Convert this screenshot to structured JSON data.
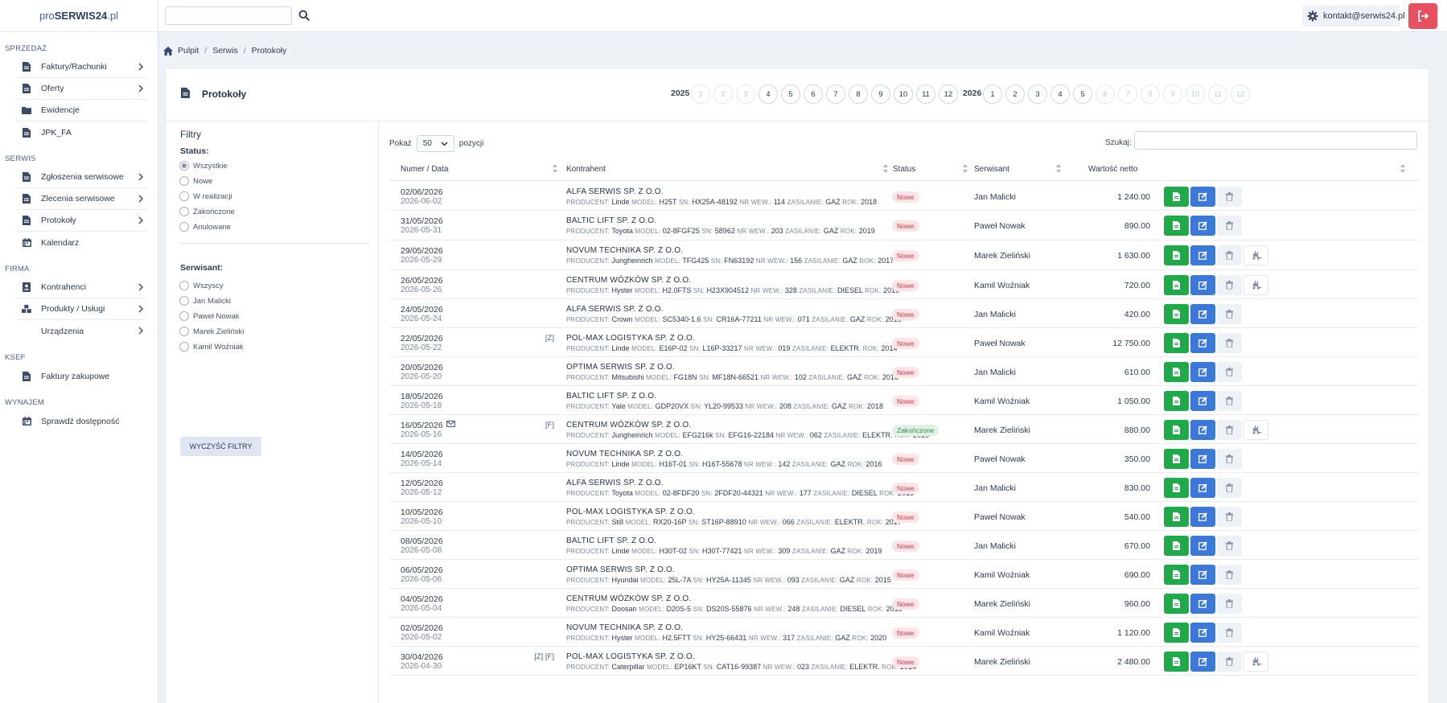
{
  "brand": {
    "prefix": "pro",
    "name": "SERWIS24",
    "suffix": ".pl"
  },
  "sidebar": {
    "sections": [
      {
        "title": "SPRZEDAŻ",
        "items": [
          {
            "label": "Faktury/Rachunki",
            "icon": "document-icon",
            "chevron": true
          },
          {
            "label": "Oferty",
            "icon": "document-icon",
            "chevron": true
          },
          {
            "label": "Ewidencje",
            "icon": "folder-icon",
            "chevron": false
          },
          {
            "label": "JPK_FA",
            "icon": "document-icon",
            "chevron": false
          }
        ]
      },
      {
        "title": "SERWIS",
        "items": [
          {
            "label": "Zgłoszenia serwisowe",
            "icon": "document-icon",
            "chevron": true
          },
          {
            "label": "Zlecenia serwisowe",
            "icon": "document-icon",
            "chevron": true
          },
          {
            "label": "Protokoły",
            "icon": "document-icon",
            "chevron": true
          },
          {
            "label": "Kalendarz",
            "icon": "calendar-icon",
            "chevron": false
          }
        ]
      },
      {
        "title": "FIRMA",
        "items": [
          {
            "label": "Kontrahenci",
            "icon": "contacts-icon",
            "chevron": true
          },
          {
            "label": "Produkty / Usługi",
            "icon": "boxes-icon",
            "chevron": true
          },
          {
            "label": "Urządzenia",
            "icon": "",
            "chevron": true
          }
        ]
      },
      {
        "title": "KSeF",
        "items": [
          {
            "label": "Faktury zakupowe",
            "icon": "document-icon",
            "chevron": false
          }
        ]
      },
      {
        "title": "WYNAJEM",
        "items": [
          {
            "label": "Sprawdź dostępność",
            "icon": "calendar-icon",
            "chevron": false
          }
        ]
      }
    ]
  },
  "topbar": {
    "search_placeholder": "",
    "user_email": "kontakt@serwis24.pl"
  },
  "breadcrumb": {
    "home": "Pulpit",
    "level1": "Serwis",
    "level2": "Protokoły"
  },
  "page": {
    "title": "Protokoły"
  },
  "years": [
    {
      "year": "2025",
      "months": [
        {
          "n": "1",
          "enabled": false
        },
        {
          "n": "2",
          "enabled": false
        },
        {
          "n": "3",
          "enabled": false
        },
        {
          "n": "4",
          "enabled": true
        },
        {
          "n": "5",
          "enabled": true
        },
        {
          "n": "6",
          "enabled": true
        },
        {
          "n": "7",
          "enabled": true
        },
        {
          "n": "8",
          "enabled": true
        },
        {
          "n": "9",
          "enabled": true
        },
        {
          "n": "10",
          "enabled": true
        },
        {
          "n": "11",
          "enabled": true
        },
        {
          "n": "12",
          "enabled": true
        }
      ]
    },
    {
      "year": "2026",
      "months": [
        {
          "n": "1",
          "enabled": true
        },
        {
          "n": "2",
          "enabled": true
        },
        {
          "n": "3",
          "enabled": true
        },
        {
          "n": "4",
          "enabled": true
        },
        {
          "n": "5",
          "enabled": true
        },
        {
          "n": "6",
          "enabled": false
        },
        {
          "n": "7",
          "enabled": false
        },
        {
          "n": "8",
          "enabled": false
        },
        {
          "n": "9",
          "enabled": false
        },
        {
          "n": "10",
          "enabled": false
        },
        {
          "n": "11",
          "enabled": false
        },
        {
          "n": "12",
          "enabled": false
        }
      ]
    }
  ],
  "filters": {
    "title": "Filtry",
    "status_label": "Status:",
    "status_options": [
      "Wszystkie",
      "Nowe",
      "W realizacji",
      "Zakończone",
      "Anulowane"
    ],
    "status_selected": 0,
    "tech_label": "Serwisant:",
    "tech_options": [
      "Wszyscy",
      "Jan Malicki",
      "Paweł Nowak",
      "Marek Zieliński",
      "Kamil Woźniak"
    ],
    "tech_selected": -1,
    "clear_label": "WYCZYŚĆ FILTRY"
  },
  "table": {
    "show_prefix": "Pokaż",
    "show_value": "50",
    "show_suffix": "pozycji",
    "search_label": "Szukaj:",
    "headers": {
      "date": "Numer / Data",
      "client": "Kontrahent",
      "status": "Status",
      "tech": "Serwisant",
      "value": "Wartość netto"
    },
    "field_labels": {
      "producer": "PRODUCENT:",
      "model": "MODEL:",
      "sn": "SN:",
      "nr": "NR WEW.:",
      "power": "ZASILANIE:",
      "year": "ROK:"
    },
    "colors": {
      "new_badge": "#fde4e6",
      "done_badge": "#dff2e4",
      "pdf": "#1faa4a",
      "edit": "#3b78d8",
      "logout": "#e8505f"
    },
    "rows": [
      {
        "date": "02/06/2026",
        "date2": "2026-06-02",
        "flags": "",
        "mail": false,
        "client": "ALFA SERWIS SP. Z O.O.",
        "producer": "Linde",
        "model": "H25T",
        "sn": "HX25A-48192",
        "nr": "114",
        "power": "GAZ",
        "year": "2018",
        "status": "Nowe",
        "tech": "Jan Malicki",
        "value": "1 240.00",
        "fork": false
      },
      {
        "date": "31/05/2026",
        "date2": "2026-05-31",
        "flags": "",
        "mail": false,
        "client": "BALTIC LIFT SP. Z O.O.",
        "producer": "Toyota",
        "model": "02-8FGF25",
        "sn": "58962",
        "nr": "203",
        "power": "GAZ",
        "year": "2019",
        "status": "Nowe",
        "tech": "Paweł Nowak",
        "value": "890.00",
        "fork": false
      },
      {
        "date": "29/05/2026",
        "date2": "2026-05-29",
        "flags": "",
        "mail": false,
        "client": "NOVUM TECHNIKA SP. Z O.O.",
        "producer": "Jungheinrich",
        "model": "TFG425",
        "sn": "FN63192",
        "nr": "156",
        "power": "GAZ",
        "year": "2017",
        "status": "Nowe",
        "tech": "Marek Zieliński",
        "value": "1 630.00",
        "fork": true
      },
      {
        "date": "26/05/2026",
        "date2": "2026-05-26",
        "flags": "",
        "mail": false,
        "client": "CENTRUM WÓZKÓW SP. Z O.O.",
        "producer": "Hyster",
        "model": "H2.0FTS",
        "sn": "H23X904512",
        "nr": "328",
        "power": "DIESEL",
        "year": "2016",
        "status": "Nowe",
        "tech": "Kamil Woźniak",
        "value": "720.00",
        "fork": true
      },
      {
        "date": "24/05/2026",
        "date2": "2026-05-24",
        "flags": "",
        "mail": false,
        "client": "ALFA SERWIS SP. Z O.O.",
        "producer": "Crown",
        "model": "SC5340-1.6",
        "sn": "CR16A-77211",
        "nr": "071",
        "power": "GAZ",
        "year": "2015",
        "status": "Nowe",
        "tech": "Jan Malicki",
        "value": "420.00",
        "fork": false
      },
      {
        "date": "22/05/2026",
        "date2": "2026-05-22",
        "flags": "[Z]",
        "mail": false,
        "client": "POL-MAX LOGISTYKA SP. Z O.O.",
        "producer": "Linde",
        "model": "E16P-02",
        "sn": "L16P-33217",
        "nr": "019",
        "power": "ELEKTR.",
        "year": "2014",
        "status": "Nowe",
        "tech": "Paweł Nowak",
        "value": "12 750.00",
        "fork": false
      },
      {
        "date": "20/05/2026",
        "date2": "2026-05-20",
        "flags": "",
        "mail": false,
        "client": "OPTIMA SERWIS SP. Z O.O.",
        "producer": "Mitsubishi",
        "model": "FG18N",
        "sn": "MF18N-66521",
        "nr": "102",
        "power": "GAZ",
        "year": "2016",
        "status": "Nowe",
        "tech": "Jan Malicki",
        "value": "610.00",
        "fork": false
      },
      {
        "date": "18/05/2026",
        "date2": "2026-05-18",
        "flags": "",
        "mail": false,
        "client": "BALTIC LIFT SP. Z O.O.",
        "producer": "Yale",
        "model": "GDP20VX",
        "sn": "YL20-99533",
        "nr": "208",
        "power": "GAZ",
        "year": "2018",
        "status": "Nowe",
        "tech": "Kamil Woźniak",
        "value": "1 050.00",
        "fork": false
      },
      {
        "date": "16/05/2026",
        "date2": "2026-05-16",
        "flags": "[F]",
        "mail": true,
        "client": "CENTRUM WÓZKÓW SP. Z O.O.",
        "producer": "Jungheinrich",
        "model": "EFG216k",
        "sn": "EFG16-22184",
        "nr": "062",
        "power": "ELEKTR.",
        "year": "2015",
        "status": "Zakończone",
        "tech": "Marek Zieliński",
        "value": "880.00",
        "fork": true
      },
      {
        "date": "14/05/2026",
        "date2": "2026-05-14",
        "flags": "",
        "mail": false,
        "client": "NOVUM TECHNIKA SP. Z O.O.",
        "producer": "Linde",
        "model": "H16T-01",
        "sn": "H16T-55678",
        "nr": "142",
        "power": "GAZ",
        "year": "2016",
        "status": "Nowe",
        "tech": "Paweł Nowak",
        "value": "350.00",
        "fork": false
      },
      {
        "date": "12/05/2026",
        "date2": "2026-05-12",
        "flags": "",
        "mail": false,
        "client": "ALFA SERWIS SP. Z O.O.",
        "producer": "Toyota",
        "model": "02-8FDF20",
        "sn": "2FDF20-44321",
        "nr": "177",
        "power": "DIESEL",
        "year": "2015",
        "status": "Nowe",
        "tech": "Jan Malicki",
        "value": "830.00",
        "fork": false
      },
      {
        "date": "10/05/2026",
        "date2": "2026-05-10",
        "flags": "",
        "mail": false,
        "client": "POL-MAX LOGISTYKA SP. Z O.O.",
        "producer": "Still",
        "model": "RX20-16P",
        "sn": "ST16P-88910",
        "nr": "066",
        "power": "ELEKTR.",
        "year": "2017",
        "status": "Nowe",
        "tech": "Paweł Nowak",
        "value": "540.00",
        "fork": false
      },
      {
        "date": "08/05/2026",
        "date2": "2026-05-08",
        "flags": "",
        "mail": false,
        "client": "BALTIC LIFT SP. Z O.O.",
        "producer": "Linde",
        "model": "H30T-02",
        "sn": "H30T-77421",
        "nr": "309",
        "power": "GAZ",
        "year": "2019",
        "status": "Nowe",
        "tech": "Jan Malicki",
        "value": "670.00",
        "fork": false
      },
      {
        "date": "06/05/2026",
        "date2": "2026-05-06",
        "flags": "",
        "mail": false,
        "client": "OPTIMA SERWIS SP. Z O.O.",
        "producer": "Hyundai",
        "model": "25L-7A",
        "sn": "HY25A-11345",
        "nr": "093",
        "power": "GAZ",
        "year": "2015",
        "status": "Nowe",
        "tech": "Kamil Woźniak",
        "value": "690.00",
        "fork": false
      },
      {
        "date": "04/05/2026",
        "date2": "2026-05-04",
        "flags": "",
        "mail": false,
        "client": "CENTRUM WÓZKÓW SP. Z O.O.",
        "producer": "Doosan",
        "model": "D20S-5",
        "sn": "DS20S-55876",
        "nr": "248",
        "power": "DIESEL",
        "year": "2018",
        "status": "Nowe",
        "tech": "Marek Zieliński",
        "value": "960.00",
        "fork": false
      },
      {
        "date": "02/05/2026",
        "date2": "2026-05-02",
        "flags": "",
        "mail": false,
        "client": "NOVUM TECHNIKA SP. Z O.O.",
        "producer": "Hyster",
        "model": "H2.5FTT",
        "sn": "HY25-66431",
        "nr": "317",
        "power": "GAZ",
        "year": "2020",
        "status": "Nowe",
        "tech": "Kamil Woźniak",
        "value": "1 120.00",
        "fork": false
      },
      {
        "date": "30/04/2026",
        "date2": "2026-04-30",
        "flags": "[Z] [F]",
        "mail": false,
        "client": "POL-MAX LOGISTYKA SP. Z O.O.",
        "producer": "Caterpillar",
        "model": "EP16KT",
        "sn": "CAT16-99387",
        "nr": "023",
        "power": "ELEKTR.",
        "year": "2014",
        "status": "Nowe",
        "tech": "Marek Zieliński",
        "value": "2 480.00",
        "fork": true
      }
    ]
  }
}
